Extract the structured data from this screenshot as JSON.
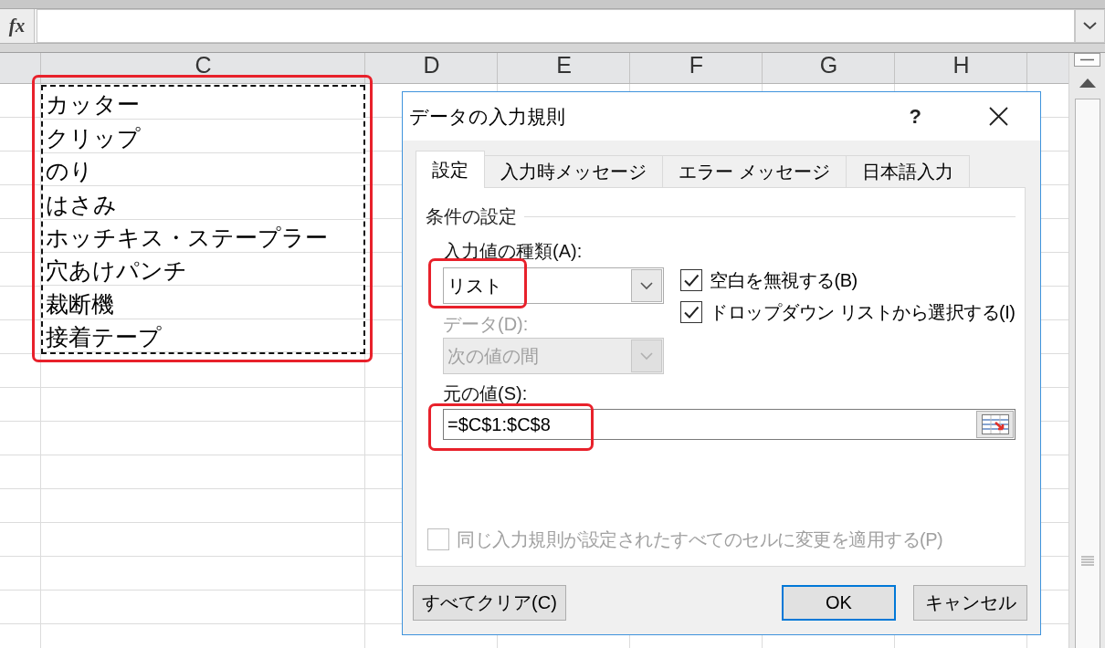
{
  "formula_bar": {
    "function_button": "fx"
  },
  "sheet": {
    "columns": [
      "C",
      "D",
      "E",
      "F",
      "G",
      "H"
    ],
    "source_range": {
      "marquee": true,
      "highlighted": true,
      "cells": [
        "カッター",
        "クリップ",
        "のり",
        "はさみ",
        "ホッチキス・ステープラー",
        "穴あけパンチ",
        "裁断機",
        "接着テープ"
      ]
    }
  },
  "dialog": {
    "title": "データの入力規則",
    "help_button": "?",
    "tabs": [
      {
        "label": "設定",
        "selected": true
      },
      {
        "label": "入力時メッセージ",
        "selected": false
      },
      {
        "label": "エラー メッセージ",
        "selected": false
      },
      {
        "label": "日本語入力",
        "selected": false
      }
    ],
    "group_title": "条件の設定",
    "allow": {
      "label": "入力値の種類(A):",
      "value": "リスト",
      "highlighted": true
    },
    "options": [
      {
        "label": "空白を無視する(B)",
        "checked": true
      },
      {
        "label": "ドロップダウン リストから選択する(I)",
        "checked": true
      }
    ],
    "data": {
      "label": "データ(D):",
      "value": "次の値の間",
      "disabled": true
    },
    "source": {
      "label": "元の値(S):",
      "value": "=$C$1:$C$8",
      "highlighted": true
    },
    "apply_all": {
      "label": "同じ入力規則が設定されたすべてのセルに変更を適用する(P)",
      "checked": false,
      "disabled": true
    },
    "buttons": [
      {
        "label": "すべてクリア(C)",
        "default": false
      },
      {
        "label": "OK",
        "default": true
      },
      {
        "label": "キャンセル",
        "default": false
      }
    ]
  }
}
